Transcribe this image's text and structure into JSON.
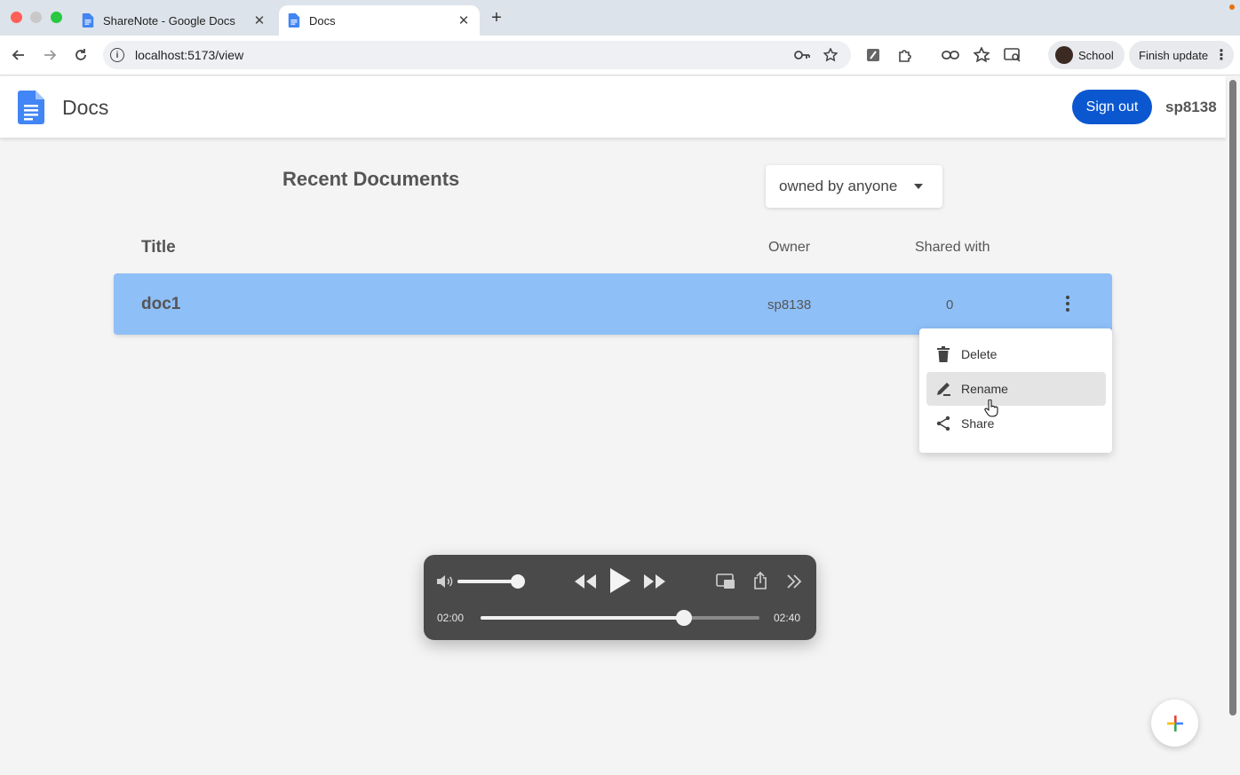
{
  "browser": {
    "tabs": [
      {
        "title": "ShareNote - Google Docs",
        "close": "✕"
      },
      {
        "title": "Docs",
        "close": "✕"
      }
    ],
    "new_tab": "+",
    "address": "localhost:5173/view",
    "profile_label": "School",
    "update_label": "Finish update",
    "icons": [
      "back-icon",
      "forward-icon",
      "reload-icon",
      "info-icon",
      "key-icon",
      "star-icon",
      "extension-icon",
      "puzzle-icon",
      "link-icon",
      "reading-list-icon",
      "tab-search-icon"
    ]
  },
  "app": {
    "title": "Docs",
    "signout_label": "Sign out",
    "username": "sp8138",
    "brand_color": "#4285f4"
  },
  "documents": {
    "section_title": "Recent Documents",
    "filter_value": "owned by anyone",
    "columns": {
      "title": "Title",
      "owner": "Owner",
      "shared": "Shared with"
    },
    "rows": [
      {
        "title": "doc1",
        "owner": "sp8138",
        "shared": "0"
      }
    ],
    "row_color": "#8ebff7"
  },
  "menu": {
    "items": [
      {
        "label": "Delete",
        "icon": "trash-icon"
      },
      {
        "label": "Rename",
        "icon": "pencil-icon"
      },
      {
        "label": "Share",
        "icon": "share-icon"
      }
    ],
    "highlighted": "Rename"
  },
  "player": {
    "time_elapsed": "02:00",
    "time_total": "02:40",
    "volume": 0.9,
    "progress": 0.73
  }
}
